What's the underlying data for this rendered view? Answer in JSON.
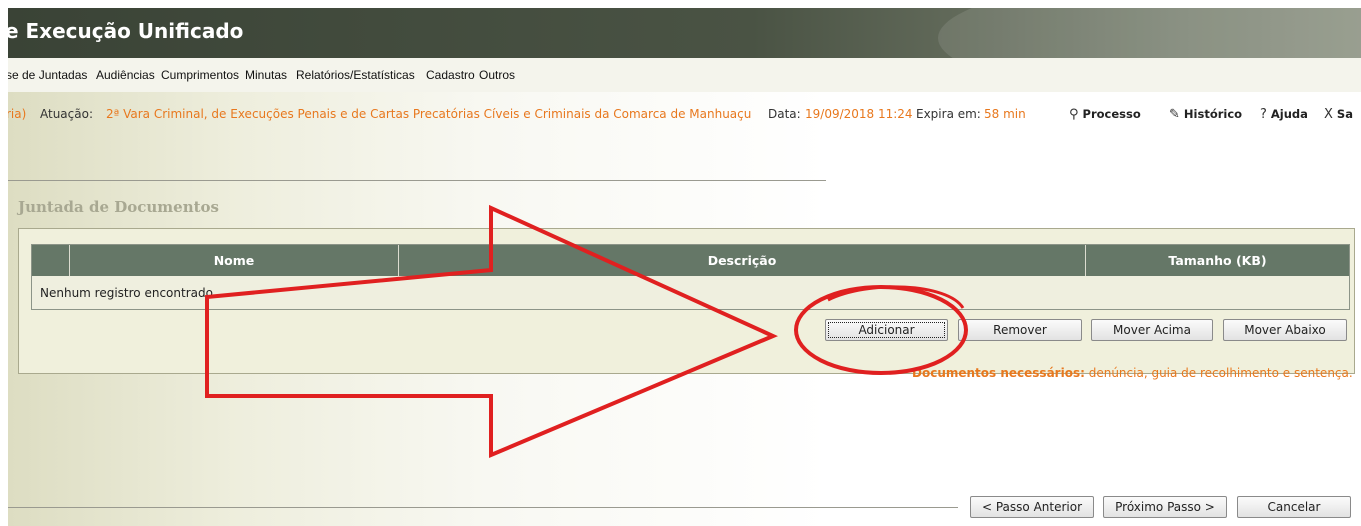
{
  "window": {
    "title": "e Execução Unificado"
  },
  "menu": {
    "items": [
      "se de Juntadas",
      "Audiências",
      "Cumprimentos",
      "Minutas",
      "Relatórios/Estatísticas",
      "Cadastro",
      "Outros"
    ]
  },
  "info": {
    "user_tail": "ria)",
    "atuacao_label": "Atuação:",
    "atuacao_value": "2ª Vara Criminal, de Execuções Penais e de Cartas Precatórias Cíveis e Criminais da Comarca de Manhuaçu",
    "data_label": "Data:",
    "data_value": "19/09/2018 11:24",
    "expira_label": "Expira em:",
    "expira_value": "58 min"
  },
  "toolbar": {
    "processo": "Processo",
    "historico": "Histórico",
    "ajuda": "Ajuda",
    "sair": "Sa"
  },
  "section": {
    "title": "Juntada de Documentos"
  },
  "table": {
    "columns": [
      "Nome",
      "Descrição",
      "Tamanho (KB)"
    ],
    "empty_message": "Nenhum registro encontrado."
  },
  "actions": {
    "add": "Adicionar",
    "remove": "Remover",
    "move_up": "Mover Acima",
    "move_down": "Mover Abaixo"
  },
  "required_docs": {
    "label": "Documentos necessários:",
    "value": "denúncia, guia de recolhimento e sentença."
  },
  "wizard": {
    "prev": "< Passo Anterior",
    "next": "Próximo Passo >",
    "cancel": "Cancelar"
  },
  "colors": {
    "title_bar": "#3a4336",
    "header_green": "#657767",
    "accent_orange": "#e8781e",
    "annotation_red": "#e02020"
  },
  "icons": {
    "processo": "magnifier-icon",
    "historico": "pencil-icon",
    "ajuda": "question-icon",
    "sair": "close-icon"
  }
}
